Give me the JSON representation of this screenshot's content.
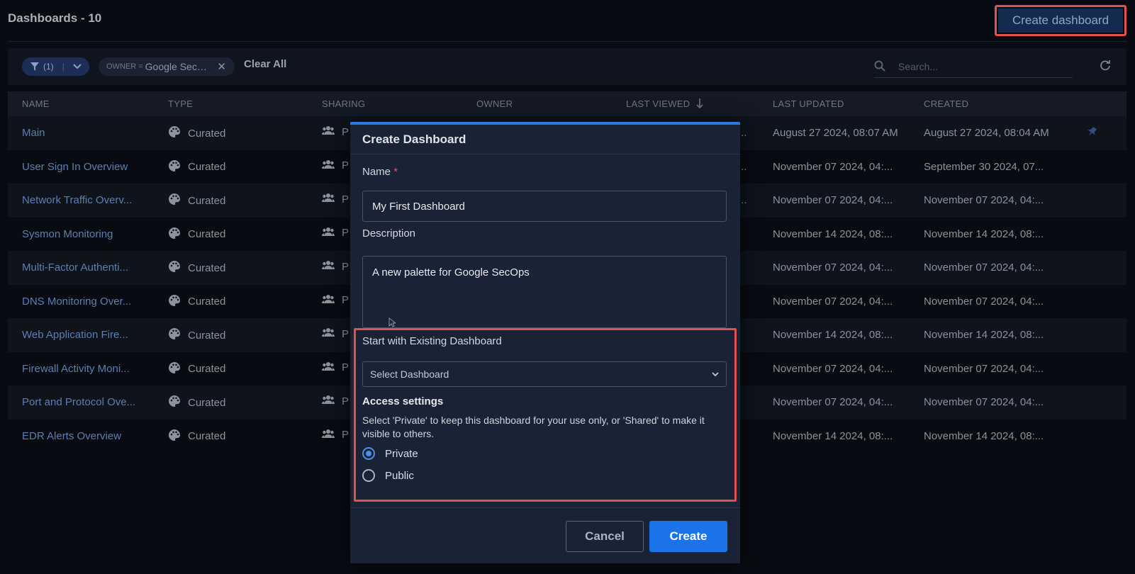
{
  "header": {
    "title": "Dashboards - 10",
    "create_button": "Create dashboard"
  },
  "filters": {
    "filter_count": "(1)",
    "chip_key": "OWNER =",
    "chip_value": "Google SecOps",
    "clear_all": "Clear All",
    "search_placeholder": "Search..."
  },
  "table": {
    "columns": [
      "NAME",
      "TYPE",
      "SHARING",
      "OWNER",
      "LAST VIEWED",
      "LAST UPDATED",
      "CREATED"
    ],
    "rows": [
      {
        "name": "Main",
        "type": "Curated",
        "sharing": "P",
        "clip": "...",
        "last_updated": "August 27 2024, 08:07 AM",
        "created": "August 27 2024, 08:04 AM"
      },
      {
        "name": "User Sign In Overview",
        "type": "Curated",
        "sharing": "P",
        "clip": "...",
        "last_updated": "November 07 2024, 04:...",
        "created": "September 30 2024, 07..."
      },
      {
        "name": "Network Traffic Overv...",
        "type": "Curated",
        "sharing": "P",
        "clip": "...",
        "last_updated": "November 07 2024, 04:...",
        "created": "November 07 2024, 04:..."
      },
      {
        "name": "Sysmon Monitoring",
        "type": "Curated",
        "sharing": "P",
        "clip": "",
        "last_updated": "November 14 2024, 08:...",
        "created": "November 14 2024, 08:..."
      },
      {
        "name": "Multi-Factor Authenti...",
        "type": "Curated",
        "sharing": "P",
        "clip": "",
        "last_updated": "November 07 2024, 04:...",
        "created": "November 07 2024, 04:..."
      },
      {
        "name": "DNS Monitoring Over...",
        "type": "Curated",
        "sharing": "P",
        "clip": "",
        "last_updated": "November 07 2024, 04:...",
        "created": "November 07 2024, 04:..."
      },
      {
        "name": "Web Application Fire...",
        "type": "Curated",
        "sharing": "P",
        "clip": "",
        "last_updated": "November 14 2024, 08:...",
        "created": "November 14 2024, 08:..."
      },
      {
        "name": "Firewall Activity Moni...",
        "type": "Curated",
        "sharing": "P",
        "clip": "",
        "last_updated": "November 07 2024, 04:...",
        "created": "November 07 2024, 04:..."
      },
      {
        "name": "Port and Protocol Ove...",
        "type": "Curated",
        "sharing": "P",
        "clip": "",
        "last_updated": "November 07 2024, 04:...",
        "created": "November 07 2024, 04:..."
      },
      {
        "name": "EDR Alerts Overview",
        "type": "Curated",
        "sharing": "P",
        "clip": "",
        "last_updated": "November 14 2024, 08:...",
        "created": "November 14 2024, 08:..."
      }
    ]
  },
  "modal": {
    "title": "Create Dashboard",
    "name_label": "Name",
    "required_mark": "*",
    "name_value": "My First Dashboard",
    "description_label": "Description",
    "description_value": "A new palette for Google SecOps",
    "existing_label": "Start with Existing Dashboard",
    "select_value": "Select Dashboard",
    "access_title": "Access settings",
    "access_desc": "Select 'Private' to keep this dashboard for your use only, or 'Shared' to make it visible to others.",
    "option_private": "Private",
    "option_public": "Public",
    "cancel": "Cancel",
    "create": "Create"
  }
}
